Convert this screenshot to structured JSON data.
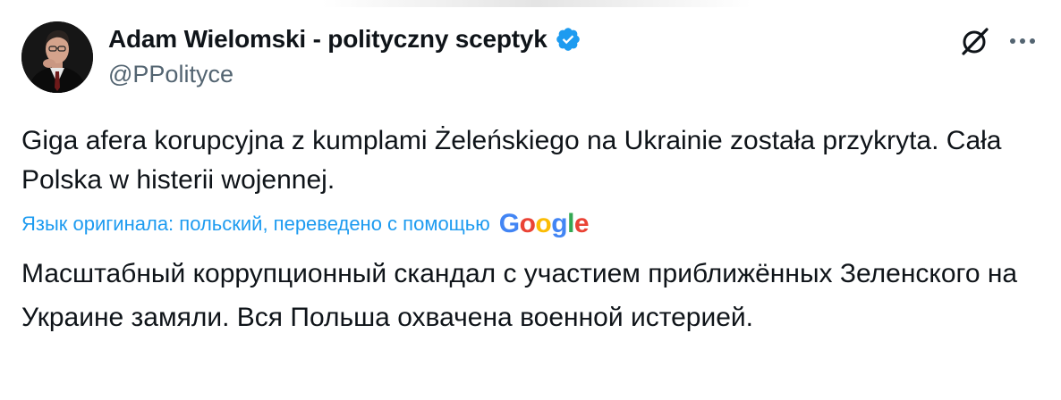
{
  "author": {
    "display_name": "Adam Wielomski - polityczny sceptyk",
    "handle": "@PPolityce",
    "verified": true
  },
  "tweet": {
    "text": "Giga afera korupcyjna z kumplami Żeleńskiego na Ukrainie została przykryta. Cała Polska w histerii wojennej."
  },
  "translation": {
    "label": "Язык оригинала: польский, переведено с помощью",
    "provider_letters": [
      "G",
      "o",
      "o",
      "g",
      "l",
      "e"
    ],
    "text": "Масштабный коррупционный скандал с участием приближённых Зеленского на Украине замяли. Вся Польша охвачена военной истерией."
  },
  "icons": {
    "verified": "verified-badge-icon",
    "grok": "grok-icon",
    "more": "more-options-icon"
  },
  "colors": {
    "accent": "#1d9bf0",
    "text": "#0f1419",
    "secondary": "#536471",
    "google_blue": "#4285f4",
    "google_red": "#ea4335",
    "google_yellow": "#fbbc05",
    "google_green": "#34a853"
  }
}
